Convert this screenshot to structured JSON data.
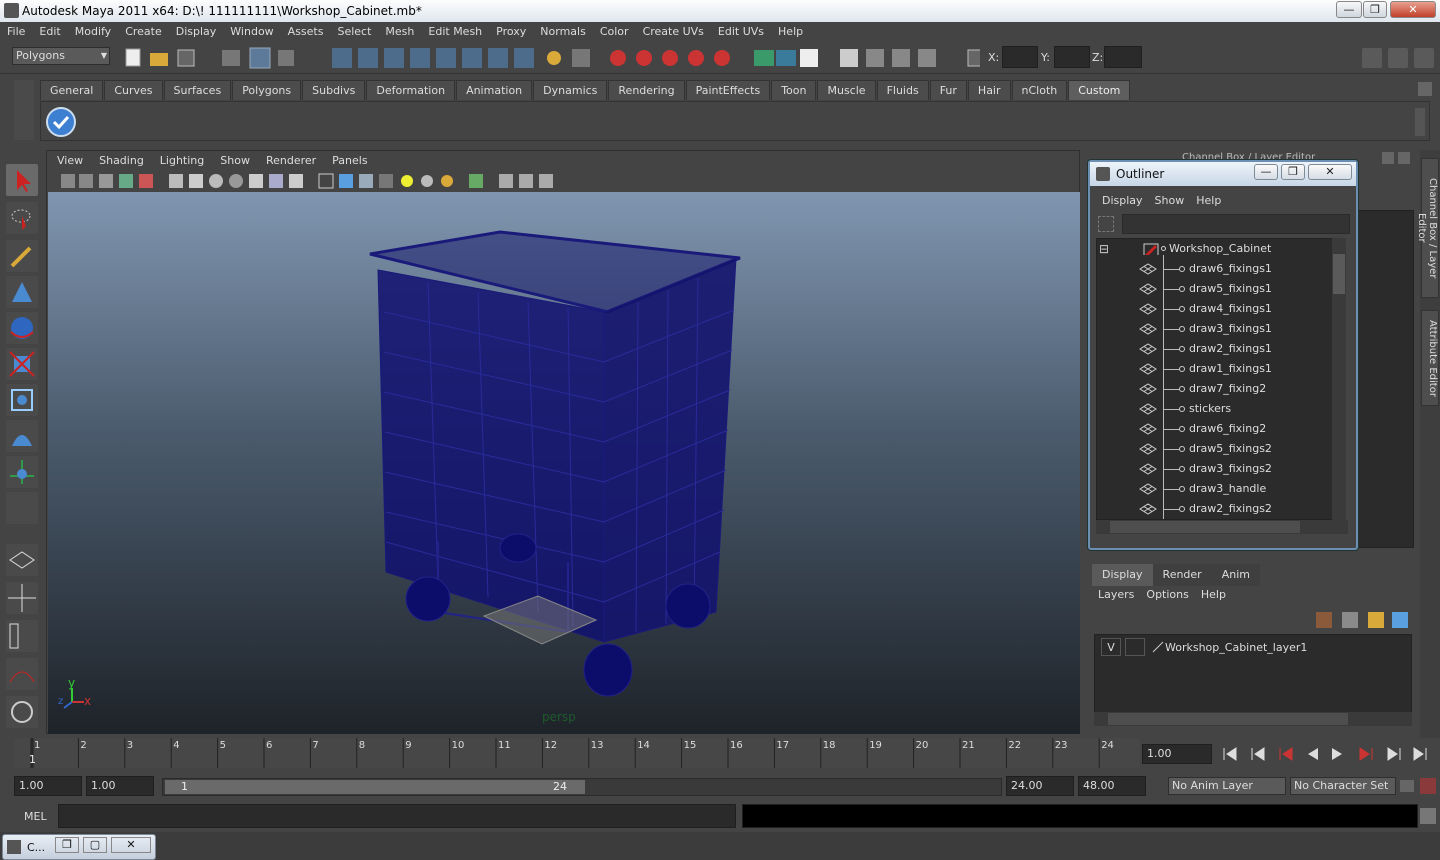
{
  "window": {
    "title": "Autodesk Maya 2011 x64: D:\\! 111111111\\Workshop_Cabinet.mb*",
    "minimize": "—",
    "maximize": "❐",
    "close": "✕"
  },
  "menubar": [
    "File",
    "Edit",
    "Modify",
    "Create",
    "Display",
    "Window",
    "Assets",
    "Select",
    "Mesh",
    "Edit Mesh",
    "Proxy",
    "Normals",
    "Color",
    "Create UVs",
    "Edit UVs",
    "Help"
  ],
  "statusline": {
    "menuset": "Polygons",
    "x_label": "X:",
    "y_label": "Y:",
    "z_label": "Z:"
  },
  "shelf": {
    "tabs": [
      "General",
      "Curves",
      "Surfaces",
      "Polygons",
      "Subdivs",
      "Deformation",
      "Animation",
      "Dynamics",
      "Rendering",
      "PaintEffects",
      "Toon",
      "Muscle",
      "Fluids",
      "Fur",
      "Hair",
      "nCloth",
      "Custom"
    ],
    "active_tab": "Custom"
  },
  "viewport": {
    "menu": [
      "View",
      "Shading",
      "Lighting",
      "Show",
      "Renderer",
      "Panels"
    ],
    "camera_label": "persp",
    "axis_y": "y",
    "axis_x": "x",
    "axis_z": "z",
    "wire_color": "#1a1a7a"
  },
  "channel_box": {
    "header": "Channel Box / Layer Editor"
  },
  "outliner": {
    "title": "Outliner",
    "menu": [
      "Display",
      "Show",
      "Help"
    ],
    "root": "Workshop_Cabinet",
    "items": [
      "draw6_fixings1",
      "draw5_fixings1",
      "draw4_fixings1",
      "draw3_fixings1",
      "draw2_fixings1",
      "draw1_fixings1",
      "draw7_fixing2",
      "stickers",
      "draw6_fixing2",
      "draw5_fixings2",
      "draw3_fixings2",
      "draw3_handle",
      "draw2_fixings2"
    ],
    "expand_symbol": "⊟",
    "minimize": "—",
    "maximize": "❐",
    "close": "✕"
  },
  "layer_editor": {
    "tabs": [
      "Display",
      "Render",
      "Anim"
    ],
    "active_tab": "Display",
    "menu": [
      "Layers",
      "Options",
      "Help"
    ],
    "layer": {
      "visible": "V",
      "name": "Workshop_Cabinet_layer1"
    }
  },
  "side_tabs": [
    "Channel Box / Layer Editor",
    "Attribute Editor"
  ],
  "timeline": {
    "ticks": [
      "1",
      "2",
      "3",
      "4",
      "5",
      "6",
      "7",
      "8",
      "9",
      "10",
      "11",
      "12",
      "13",
      "14",
      "15",
      "16",
      "17",
      "18",
      "19",
      "20",
      "21",
      "22",
      "23",
      "24"
    ],
    "current_frame": "1",
    "current_time_field": "1.00"
  },
  "range": {
    "start_time": "1.00",
    "playback_start": "1.00",
    "range_start": "1",
    "range_end": "24",
    "playback_end": "24.00",
    "end_time": "48.00",
    "anim_layer": "No Anim Layer",
    "character_set": "No Character Set"
  },
  "command_line": {
    "label": "MEL"
  },
  "minimized_window": {
    "label": "C..."
  }
}
